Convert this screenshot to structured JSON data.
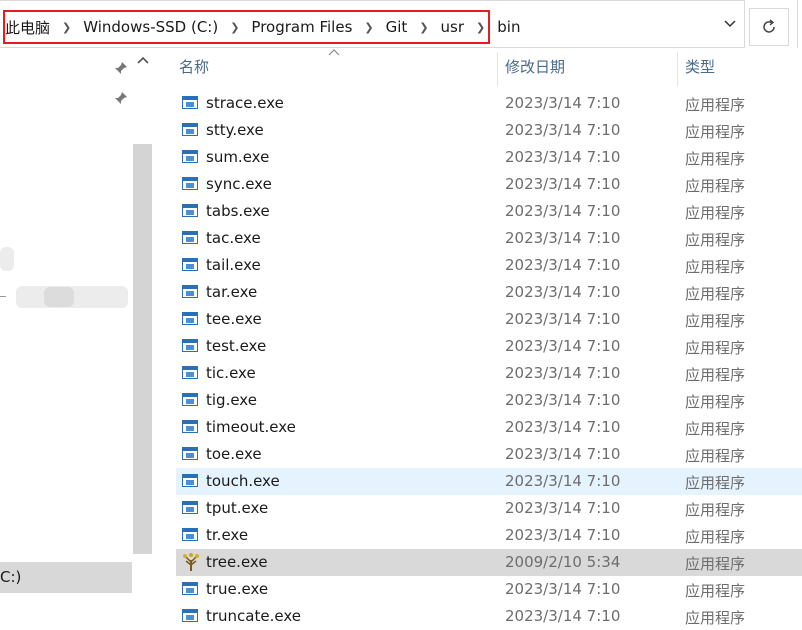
{
  "address": {
    "crumbs": [
      "此电脑",
      "Windows-SSD (C:)",
      "Program Files",
      "Git",
      "usr",
      "bin"
    ],
    "dropdown_icon": "chevron-down-icon",
    "refresh_icon": "refresh-icon"
  },
  "nav": {
    "selected_label": "C:)"
  },
  "columns": {
    "name": "名称",
    "date": "修改日期",
    "type": "类型"
  },
  "files": [
    {
      "name": "strace.exe",
      "date": "2023/3/14 7:10",
      "type": "应用程序"
    },
    {
      "name": "stty.exe",
      "date": "2023/3/14 7:10",
      "type": "应用程序"
    },
    {
      "name": "sum.exe",
      "date": "2023/3/14 7:10",
      "type": "应用程序"
    },
    {
      "name": "sync.exe",
      "date": "2023/3/14 7:10",
      "type": "应用程序"
    },
    {
      "name": "tabs.exe",
      "date": "2023/3/14 7:10",
      "type": "应用程序"
    },
    {
      "name": "tac.exe",
      "date": "2023/3/14 7:10",
      "type": "应用程序"
    },
    {
      "name": "tail.exe",
      "date": "2023/3/14 7:10",
      "type": "应用程序"
    },
    {
      "name": "tar.exe",
      "date": "2023/3/14 7:10",
      "type": "应用程序"
    },
    {
      "name": "tee.exe",
      "date": "2023/3/14 7:10",
      "type": "应用程序"
    },
    {
      "name": "test.exe",
      "date": "2023/3/14 7:10",
      "type": "应用程序"
    },
    {
      "name": "tic.exe",
      "date": "2023/3/14 7:10",
      "type": "应用程序"
    },
    {
      "name": "tig.exe",
      "date": "2023/3/14 7:10",
      "type": "应用程序"
    },
    {
      "name": "timeout.exe",
      "date": "2023/3/14 7:10",
      "type": "应用程序"
    },
    {
      "name": "toe.exe",
      "date": "2023/3/14 7:10",
      "type": "应用程序"
    },
    {
      "name": "touch.exe",
      "date": "2023/3/14 7:10",
      "type": "应用程序",
      "state": "hover"
    },
    {
      "name": "tput.exe",
      "date": "2023/3/14 7:10",
      "type": "应用程序"
    },
    {
      "name": "tr.exe",
      "date": "2023/3/14 7:10",
      "type": "应用程序"
    },
    {
      "name": "tree.exe",
      "date": "2009/2/10 5:34",
      "type": "应用程序",
      "state": "selected",
      "icon": "tree-icon"
    },
    {
      "name": "true.exe",
      "date": "2023/3/14 7:10",
      "type": "应用程序"
    },
    {
      "name": "truncate.exe",
      "date": "2023/3/14 7:10",
      "type": "应用程序"
    }
  ]
}
